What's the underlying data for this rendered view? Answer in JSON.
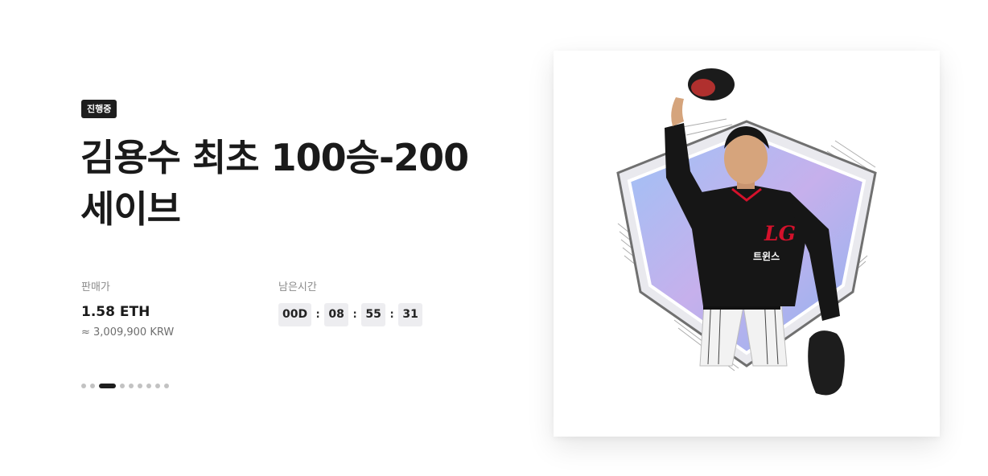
{
  "status_badge": "진행중",
  "title_line1": "김용수 최초 100승-200",
  "title_line2": "세이브",
  "price": {
    "label": "판매가",
    "value": "1.58 ETH",
    "krw": "≈ 3,009,900 KRW"
  },
  "countdown": {
    "label": "남은시간",
    "days": "00D",
    "hours": "08",
    "minutes": "55",
    "seconds": "31",
    "separator": ":"
  },
  "pagination": {
    "total": 9,
    "active_index": 2
  },
  "card": {
    "image_icon": "baseball-player-card-image",
    "jersey_logo": "LG",
    "jersey_text": "트윈스"
  },
  "colors": {
    "badge_bg": "#1e1e1e",
    "timer_bg": "#ededf0",
    "dot_active": "#1e1e1e",
    "dot_inactive": "#c2c2c2",
    "shield_blue": "#8fb4f0",
    "shield_purple": "#c6b0ec",
    "jersey_red": "#d4112b"
  }
}
